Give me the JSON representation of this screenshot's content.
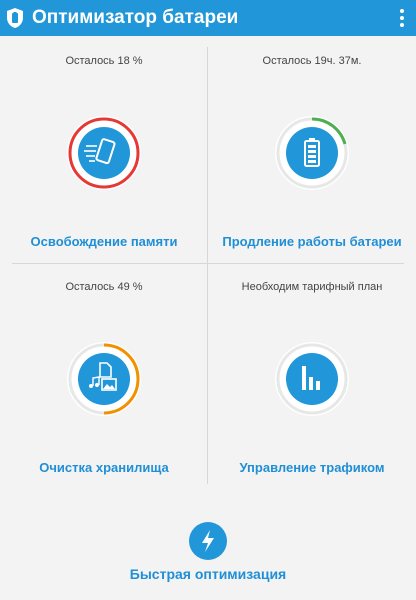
{
  "app": {
    "title": "Оптимизатор батареи"
  },
  "colors": {
    "accent": "#2196d9",
    "danger": "#e53935",
    "success": "#4caf50",
    "storage": "#f29100"
  },
  "tiles": [
    {
      "status": "Осталось 18 %",
      "label": "Освобождение памяти",
      "icon": "phone-clean-icon"
    },
    {
      "status": "Осталось 19ч. 37м.",
      "label": "Продление работы батареи",
      "icon": "battery-icon"
    },
    {
      "status": "Осталось 49 %",
      "label": "Очистка хранилища",
      "icon": "storage-files-icon"
    },
    {
      "status": "Необходим тарифный план",
      "label": "Управление трафиком",
      "icon": "traffic-chart-icon"
    }
  ],
  "quick": {
    "label": "Быстрая оптимизация",
    "icon": "lightning-icon"
  }
}
